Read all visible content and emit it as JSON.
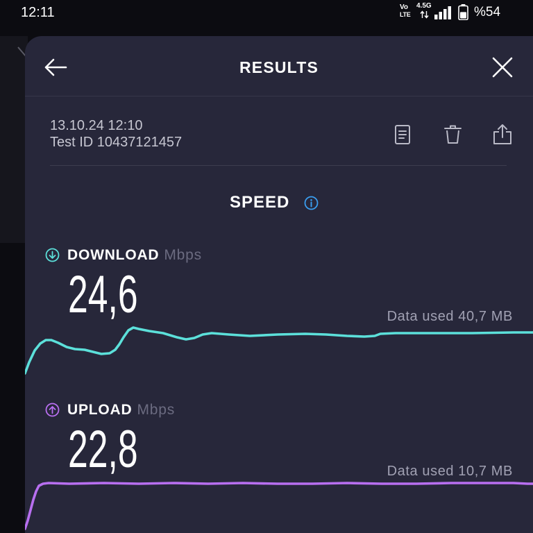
{
  "status_bar": {
    "time": "12:11",
    "volte_top": "Vo",
    "volte_bottom": "LTE",
    "network_type": "4.5G",
    "signal_bars": 4,
    "battery_level": 0.54,
    "battery_text": "%54",
    "icons": [
      "volte-icon",
      "network-activity-icon",
      "signal-icon",
      "battery-icon"
    ]
  },
  "header": {
    "title": "RESULTS",
    "back_icon": "arrow-left-icon",
    "close_icon": "close-icon"
  },
  "test_info": {
    "datetime": "13.10.24 12:10",
    "test_id": "Test ID 10437121457"
  },
  "actions": {
    "icons": [
      "document-icon",
      "trash-icon",
      "share-icon"
    ]
  },
  "speed": {
    "title": "SPEED",
    "info_icon": "info-icon",
    "info_color": "#3a9ef0"
  },
  "download": {
    "icon": "download-arrow-icon",
    "label": "DOWNLOAD",
    "unit": "Mbps",
    "value": "24,6",
    "data_used": "Data used 40,7 MB",
    "color": "#5ce0da"
  },
  "upload": {
    "icon": "upload-arrow-icon",
    "label": "UPLOAD",
    "unit": "Mbps",
    "value": "22,8",
    "data_used": "Data used 10,7 MB",
    "color": "#b86ff0"
  },
  "colors": {
    "background": "#0c0c11",
    "sheet": "#27273a",
    "muted_text": "#a1a1b3",
    "unit_text": "#6b6b80"
  }
}
